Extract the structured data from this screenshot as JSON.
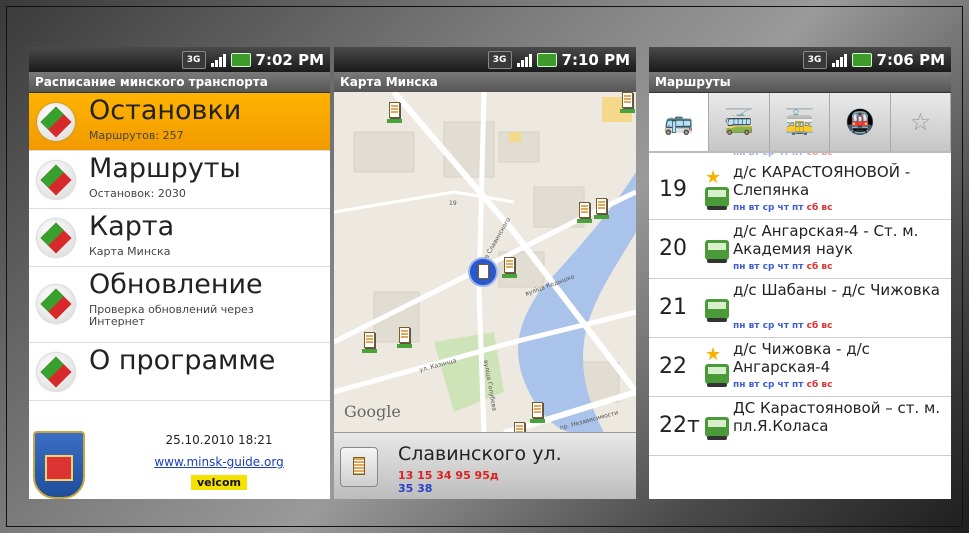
{
  "panel1": {
    "status_time": "7:02 PM",
    "network_label": "3G",
    "title": "Расписание минского транспорта",
    "items": [
      {
        "title": "Остановки",
        "sub": "Маршрутов: 257"
      },
      {
        "title": "Маршруты",
        "sub": "Остановок: 2030"
      },
      {
        "title": "Карта",
        "sub": "Карта Минска"
      },
      {
        "title": "Обновление",
        "sub": "Проверка обновлений через Интернет"
      },
      {
        "title": "О программе",
        "sub": ""
      }
    ],
    "footer": {
      "date": "25.10.2010 18:21",
      "link": "www.minsk-guide.org",
      "brand": "velcom"
    },
    "colors": {
      "active_item": "#f9a800",
      "diamond_red": "#d7282a",
      "diamond_green": "#37a12e"
    }
  },
  "panel2": {
    "status_time": "7:10 PM",
    "network_label": "3G",
    "title": "Карта Минска",
    "map_logo": "Google",
    "street_labels": [
      "ул. Казинца",
      "вулiца Славинского",
      "вулiца Кедышко",
      "вулiца Голубева",
      "пр. Независимости",
      "19"
    ],
    "selected_stop": {
      "name": "Славинского ул.",
      "routes_red": "13 15 34 95 95д",
      "routes_blue": "35 38"
    }
  },
  "panel3": {
    "status_time": "7:06 PM",
    "network_label": "3G",
    "title": "Маршруты",
    "tabs": [
      "bus-icon",
      "trolleybus-icon",
      "tram-icon",
      "metro-icon",
      "star-icon"
    ],
    "days_label_weekday": "пн вт ср чт пт",
    "days_label_weekend": "сб вс",
    "routes": [
      {
        "num": "19",
        "favorite": true,
        "name": "д/с КАРАСТОЯНОВОЙ - Слепянка"
      },
      {
        "num": "20",
        "favorite": false,
        "name": "д/с Ангарская-4 - Ст. м. Академия наук"
      },
      {
        "num": "21",
        "favorite": false,
        "name": "д/с Шабаны - д/с Чижовка"
      },
      {
        "num": "22",
        "favorite": true,
        "name": "д/с Чижовка - д/с Ангарская-4"
      },
      {
        "num": "22т",
        "favorite": false,
        "name": "ДС Карастояновой – ст. м. пл.Я.Коласа"
      }
    ]
  }
}
